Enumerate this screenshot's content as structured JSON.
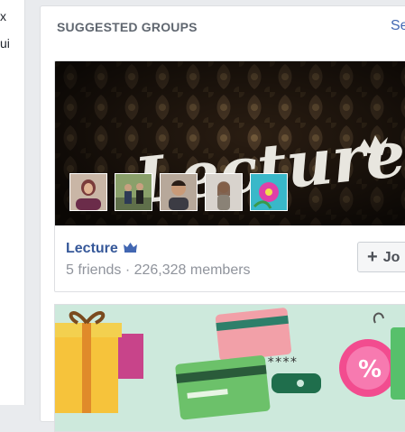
{
  "left_column": {
    "fragments": [
      "x",
      "ui"
    ]
  },
  "panel": {
    "title": "SUGGESTED GROUPS",
    "see_all": "Se"
  },
  "group": {
    "name": "Lecture",
    "cover_text": "Lecture",
    "meta": "5 friends · 226,328 members",
    "join_label": "Jo",
    "join_icon": "plus-icon",
    "badge_icon": "crown-icon"
  },
  "promo": {
    "card_stars": "****",
    "percent": "%"
  },
  "colors": {
    "link": "#365899",
    "header": "#606770",
    "muted": "#90949c",
    "background": "#e9ebee"
  }
}
